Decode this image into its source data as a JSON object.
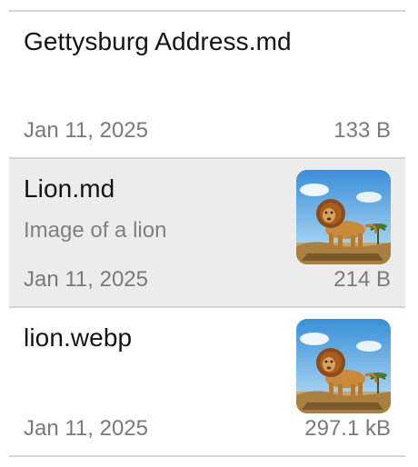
{
  "notes": [
    {
      "title": "Gettysburg Address.md",
      "subtitle": "",
      "date": "Jan 11, 2025",
      "size": "133 B",
      "has_thumbnail": false,
      "selected": false
    },
    {
      "title": "Lion.md",
      "subtitle": "Image of a lion",
      "date": "Jan 11, 2025",
      "size": "214 B",
      "has_thumbnail": true,
      "thumbnail_icon": "lion-image",
      "selected": true
    },
    {
      "title": "lion.webp",
      "subtitle": "",
      "date": "Jan 11, 2025",
      "size": "297.1 kB",
      "has_thumbnail": true,
      "thumbnail_icon": "lion-image",
      "selected": false
    }
  ],
  "colors": {
    "selected_background": "#ececec",
    "divider": "#d6d6d6",
    "muted_text": "#7a7a7a"
  }
}
